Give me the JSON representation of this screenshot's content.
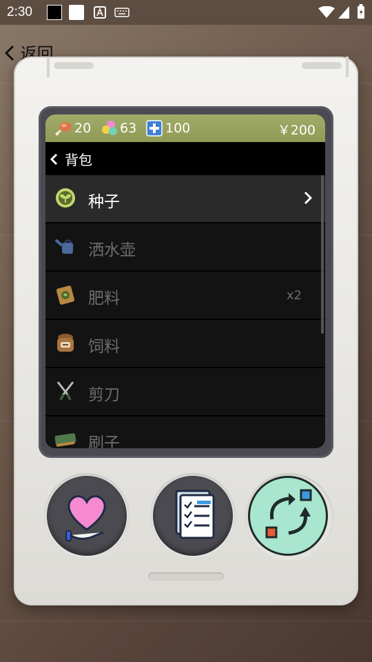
{
  "status_bar": {
    "time": "2:30"
  },
  "top_nav": {
    "back_label": "返回"
  },
  "stats": {
    "food": "20",
    "mood": "63",
    "health": "100",
    "money": "￥200"
  },
  "header": {
    "title": "背包"
  },
  "items": [
    {
      "label": "种子",
      "qty": "",
      "icon": "seed-icon",
      "selected": true
    },
    {
      "label": "洒水壶",
      "qty": "",
      "icon": "watering-can-icon",
      "selected": false
    },
    {
      "label": "肥料",
      "qty": "x2",
      "icon": "fertilizer-bag-icon",
      "selected": false
    },
    {
      "label": "饲料",
      "qty": "",
      "icon": "feed-sack-icon",
      "selected": false
    },
    {
      "label": "剪刀",
      "qty": "",
      "icon": "shears-icon",
      "selected": false
    },
    {
      "label": "刷子",
      "qty": "",
      "icon": "brush-icon",
      "selected": false
    }
  ],
  "buttons": [
    {
      "name": "care-heart-button",
      "icon": "heart-hand-icon"
    },
    {
      "name": "task-list-button",
      "icon": "checklist-icon"
    },
    {
      "name": "switch-button",
      "icon": "swap-arrows-icon",
      "active": true
    }
  ],
  "colors": {
    "stats_bar": "#9aa462",
    "switch_button_bg": "#a8e6cf",
    "heart": "#f58ad0"
  }
}
